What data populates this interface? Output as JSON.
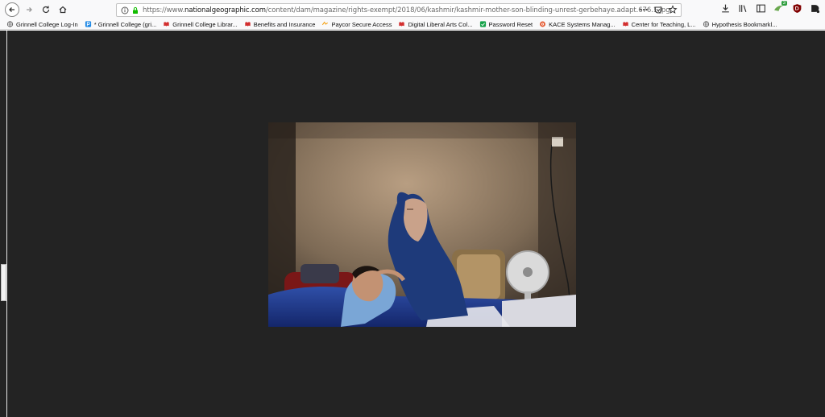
{
  "browser": {
    "url_scheme_host": "https://www.",
    "url_host_bold": "nationalgeographic.com",
    "url_path": "/content/dam/magazine/rights-exempt/2018/06/kashmir/kashmir-mother-son-blinding-unrest-gerbehaye.adapt.676.1.jpg",
    "extension_badge": "3"
  },
  "bookmarks": [
    {
      "label": "Grinnell College Log-In",
      "icon": "globe-icon",
      "color": "#555555"
    },
    {
      "label": "* Grinnell College (gri...",
      "icon": "p-icon",
      "color": "#1e88e5"
    },
    {
      "label": "Grinnell College Librar...",
      "icon": "red-book-icon",
      "color": "#d32f2f"
    },
    {
      "label": "Benefits and Insurance",
      "icon": "red-book-icon",
      "color": "#d32f2f"
    },
    {
      "label": "Paycor Secure Access",
      "icon": "paycor-icon",
      "color": "#f59e0b"
    },
    {
      "label": "Digital Liberal Arts Col...",
      "icon": "red-book-icon",
      "color": "#d32f2f"
    },
    {
      "label": "Password Reset",
      "icon": "green-square-icon",
      "color": "#16a34a"
    },
    {
      "label": "KACE Systems Manag...",
      "icon": "kace-icon",
      "color": "#e4572e"
    },
    {
      "label": "Center for Teaching, L...",
      "icon": "red-book-icon",
      "color": "#d32f2f"
    },
    {
      "label": "Hypothesis Bookmarkl...",
      "icon": "globe-icon",
      "color": "#555555"
    }
  ],
  "colors": {
    "page_background": "#232323",
    "lock_green": "#12bc00"
  }
}
